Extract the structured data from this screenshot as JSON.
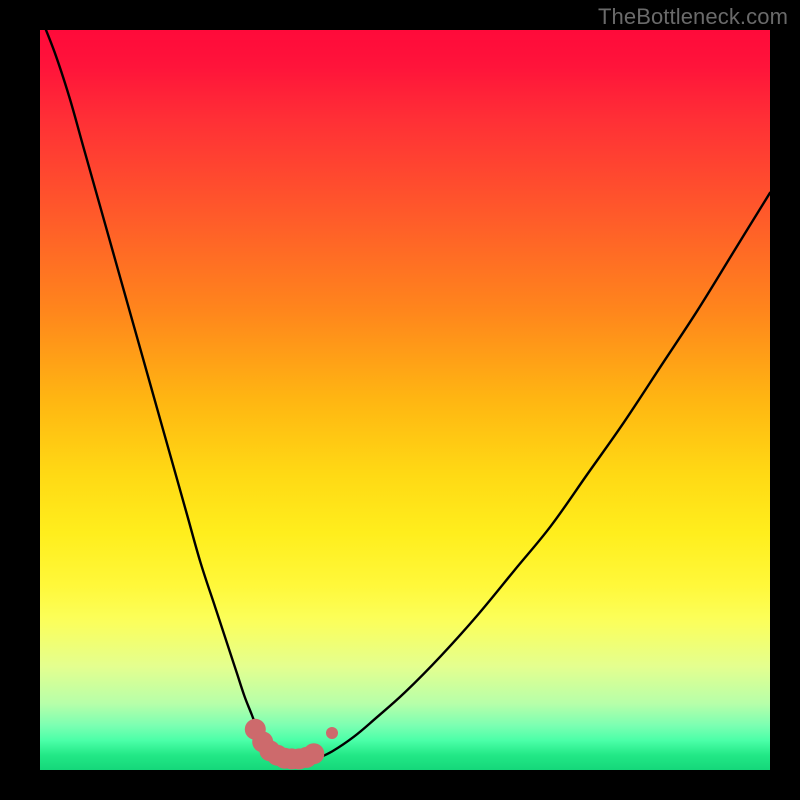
{
  "watermark": "TheBottleneck.com",
  "colors": {
    "frame": "#000000",
    "curve": "#000000",
    "markers": "#cd6a6c"
  },
  "chart_data": {
    "type": "line",
    "title": "",
    "xlabel": "",
    "ylabel": "",
    "xlim": [
      0,
      100
    ],
    "ylim": [
      0,
      100
    ],
    "grid": false,
    "legend": false,
    "series": [
      {
        "name": "bottleneck-curve",
        "x": [
          0,
          2,
          4,
          6,
          8,
          10,
          12,
          14,
          16,
          18,
          20,
          22,
          24,
          26,
          27,
          28,
          29,
          30,
          31,
          32,
          33,
          34,
          35,
          36,
          37,
          38,
          40,
          43,
          46,
          50,
          55,
          60,
          65,
          70,
          75,
          80,
          85,
          90,
          95,
          100
        ],
        "y": [
          102,
          97,
          91,
          84,
          77,
          70,
          63,
          56,
          49,
          42,
          35,
          28,
          22,
          16,
          13,
          10,
          7.5,
          5,
          3.3,
          2.2,
          1.6,
          1.3,
          1.2,
          1.2,
          1.3,
          1.6,
          2.5,
          4.5,
          7,
          10.5,
          15.5,
          21,
          27,
          33,
          40,
          47,
          54.5,
          62,
          70,
          78
        ]
      }
    ],
    "highlighted_points": {
      "comment": "salmon dotted segment near trough",
      "x": [
        29.5,
        30.5,
        31.5,
        32.5,
        33.5,
        34.5,
        35.5,
        36.5,
        37.5,
        40
      ],
      "y": [
        5.5,
        3.8,
        2.6,
        2.0,
        1.6,
        1.5,
        1.5,
        1.7,
        2.2,
        5.0
      ]
    },
    "gradient_bands_pct_from_top": {
      "red": 0,
      "orange": 35,
      "yellow": 60,
      "pale_yellow": 78,
      "pale_green": 90,
      "green": 100
    }
  }
}
